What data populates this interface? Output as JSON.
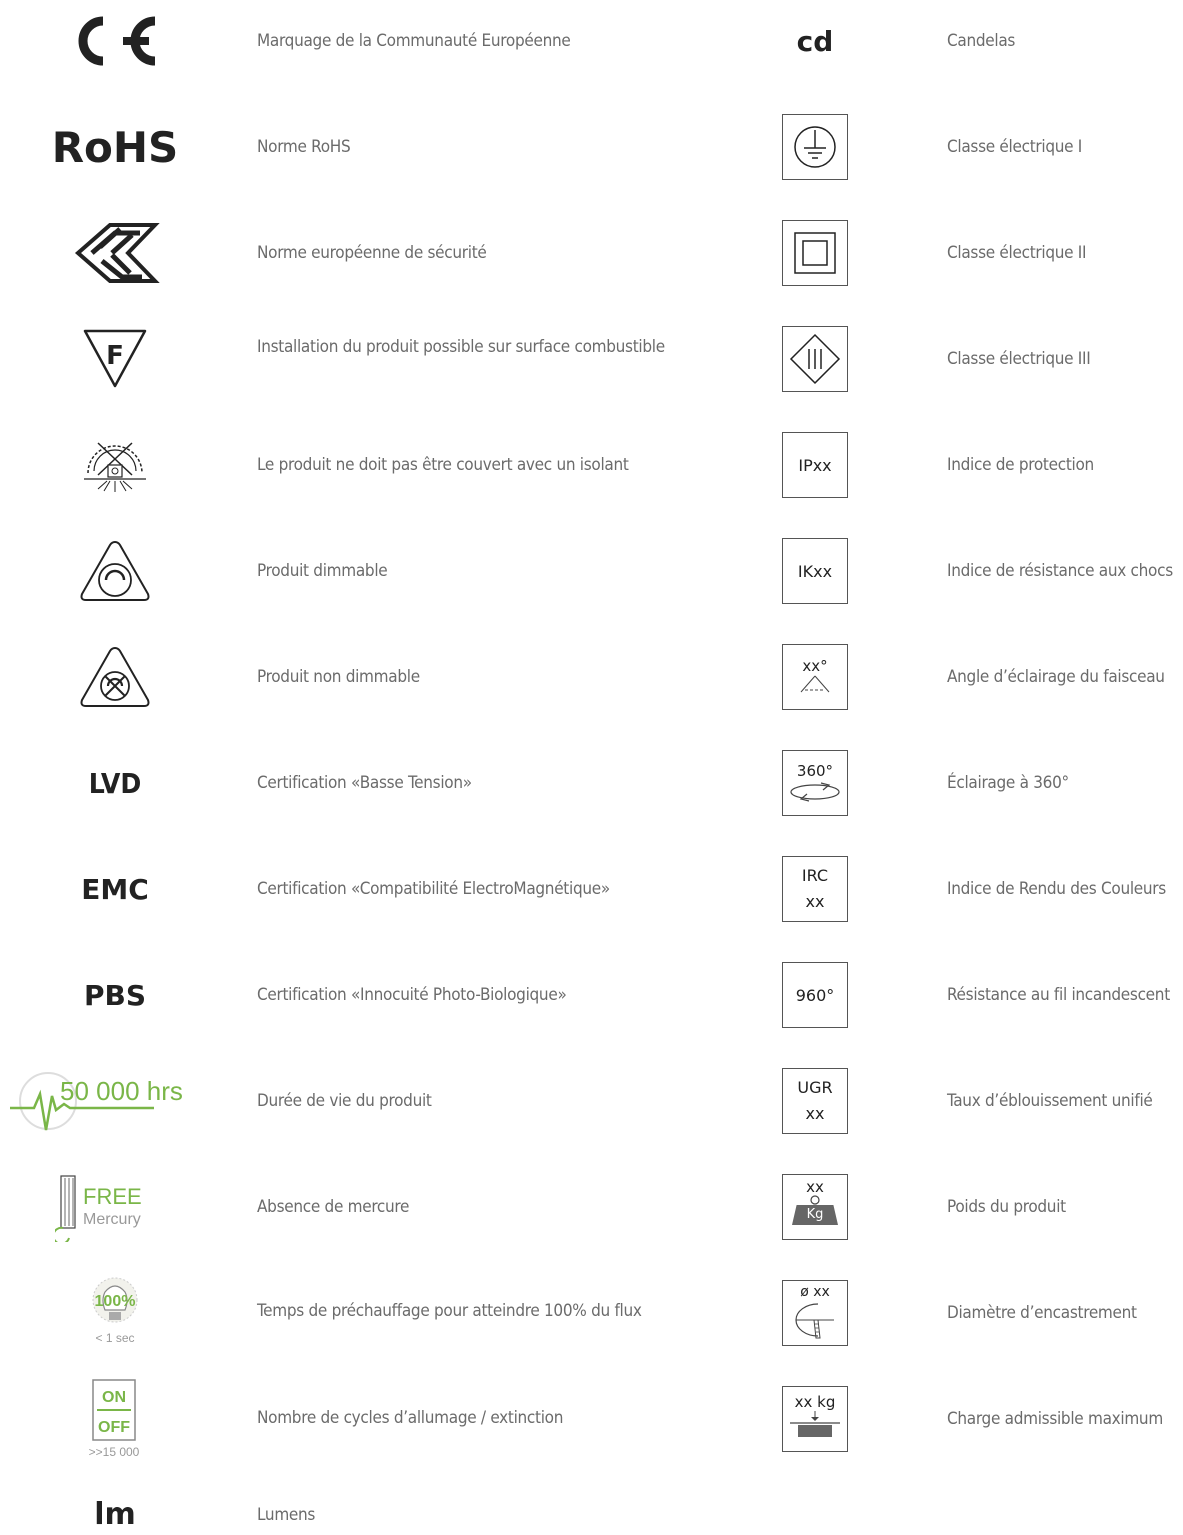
{
  "left": [
    {
      "icon": "ce-mark-icon",
      "symbol": "C E",
      "label": "Marquage de la Communauté Européenne"
    },
    {
      "icon": "rohs-icon",
      "symbol": "RoHS",
      "label": "Norme RoHS"
    },
    {
      "icon": "enec-icon",
      "symbol": "ENEC",
      "label": "Norme européenne de sécurité"
    },
    {
      "icon": "f-triangle-icon",
      "symbol": "F",
      "label": "Installation du produit possible sur surface combustible"
    },
    {
      "icon": "no-insulation-cover-icon",
      "symbol": "",
      "label": "Le produit ne doit pas être couvert avec un isolant"
    },
    {
      "icon": "dimmable-icon",
      "symbol": "",
      "label": "Produit dimmable"
    },
    {
      "icon": "non-dimmable-icon",
      "symbol": "",
      "label": "Produit non dimmable"
    },
    {
      "icon": "lvd-icon",
      "symbol": "LVD",
      "label": "Certification «Basse Tension»"
    },
    {
      "icon": "emc-icon",
      "symbol": "EMC",
      "label": "Certification «Compatibilité ElectroMagnétique»"
    },
    {
      "icon": "pbs-icon",
      "symbol": "PBS",
      "label": "Certification «Innocuité Photo-Biologique»"
    },
    {
      "icon": "lifetime-icon",
      "symbol": "50 000 hrs",
      "label": "Durée de vie du produit"
    },
    {
      "icon": "mercury-free-icon",
      "symbol": "FREE",
      "symbol2": "Mercury",
      "label": "Absence de mercure"
    },
    {
      "icon": "warmup-bulb-icon",
      "symbol": "100%",
      "symbol2": "< 1 sec",
      "label": "Temps de préchauffage pour atteindre 100% du flux"
    },
    {
      "icon": "on-off-cycles-icon",
      "symbol": "ON",
      "symbol2": "OFF",
      "symbol3": ">>15 000",
      "label": "Nombre de cycles d’allumage / extinction"
    },
    {
      "icon": "lumens-icon",
      "symbol": "lm",
      "label": "Lumens"
    }
  ],
  "right": [
    {
      "icon": "candela-icon",
      "symbol": "cd",
      "label": "Candelas"
    },
    {
      "icon": "class-1-icon",
      "symbol": "",
      "label": "Classe électrique I"
    },
    {
      "icon": "class-2-icon",
      "symbol": "",
      "label": "Classe électrique II"
    },
    {
      "icon": "class-3-icon",
      "symbol": "",
      "label": "Classe électrique III"
    },
    {
      "icon": "ip-rating-icon",
      "symbol": "IPxx",
      "label": "Indice de protection"
    },
    {
      "icon": "ik-rating-icon",
      "symbol": "IKxx",
      "label": "Indice de résistance aux chocs"
    },
    {
      "icon": "beam-angle-icon",
      "symbol": "xx°",
      "label": "Angle d’éclairage du faisceau"
    },
    {
      "icon": "360-lighting-icon",
      "symbol": "360°",
      "label": "Éclairage à 360°"
    },
    {
      "icon": "cri-icon",
      "symbol": "IRC",
      "symbol2": "xx",
      "label": "Indice de Rendu des Couleurs"
    },
    {
      "icon": "glow-wire-icon",
      "symbol": "960°",
      "label": "Résistance au fil incandescent"
    },
    {
      "icon": "ugr-icon",
      "symbol": "UGR",
      "symbol2": "xx",
      "label": "Taux d’éblouissement unifié"
    },
    {
      "icon": "weight-icon",
      "symbol": "xx",
      "symbol2": "Kg",
      "label": "Poids du produit"
    },
    {
      "icon": "cutout-diameter-icon",
      "symbol": "ø xx",
      "label": "Diamètre d’encastrement"
    },
    {
      "icon": "max-load-icon",
      "symbol": "xx kg",
      "label": "Charge admissible maximum"
    }
  ],
  "colors": {
    "accent_green": "#7ab648",
    "text": "#6b6b6b",
    "icon": "#222222"
  }
}
